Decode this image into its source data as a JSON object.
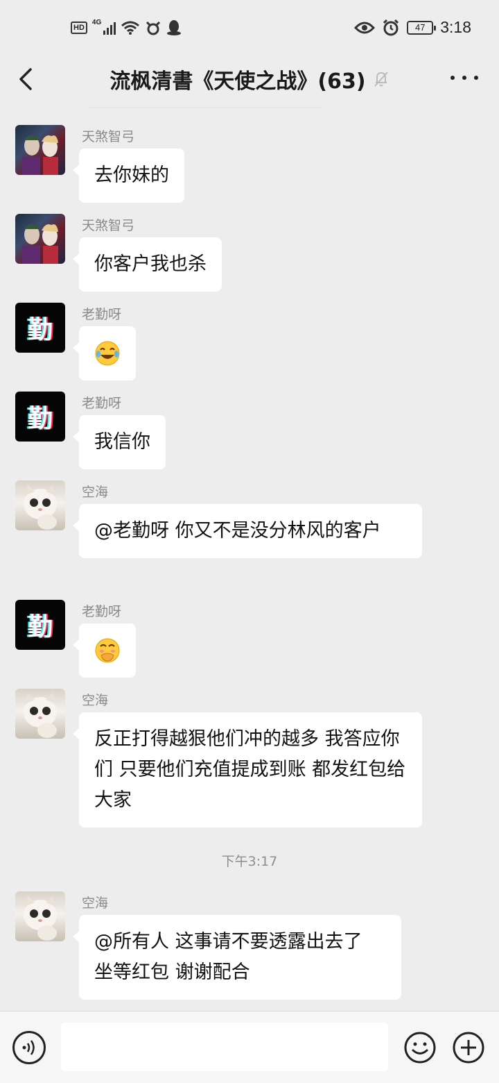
{
  "status_bar": {
    "hd": "HD",
    "network": "4G",
    "battery": "47",
    "time": "3:18"
  },
  "header": {
    "title": "流枫清書《天使之战》(63)",
    "back_icon": "back-chevron-icon",
    "mute_icon": "bell-muted-icon",
    "more_icon": "more-dots-icon"
  },
  "messages": [
    {
      "sender": "天煞智弓",
      "avatar": "joker-couple-avatar",
      "text": "去你妹的"
    },
    {
      "sender": "天煞智弓",
      "avatar": "joker-couple-avatar",
      "text": "你客户我也杀"
    },
    {
      "sender": "老勤呀",
      "avatar": "qin-char-avatar",
      "avatar_text": "勤",
      "emoji": "tears-of-joy-emoji"
    },
    {
      "sender": "老勤呀",
      "avatar": "qin-char-avatar",
      "avatar_text": "勤",
      "text": "我信你"
    },
    {
      "sender": "空海",
      "avatar": "cat-avatar",
      "text": "@老勤呀  你又不是没分林风的客户"
    },
    {
      "sender": "老勤呀",
      "avatar": "qin-char-avatar",
      "avatar_text": "勤",
      "emoji": "face-with-hand-over-mouth-emoji"
    },
    {
      "sender": "空海",
      "avatar": "cat-avatar",
      "text": "反正打得越狠他们冲的越多 我答应你们 只要他们充值提成到账 都发红包给大家"
    },
    {
      "sender": "空海",
      "avatar": "cat-avatar",
      "text": "@所有人  这事请不要透露出去了  坐等红包  谢谢配合"
    }
  ],
  "time_divider": "下午3:17",
  "input_bar": {
    "voice_icon": "voice-icon",
    "emoji_icon": "emoji-icon",
    "plus_icon": "plus-icon",
    "input_value": ""
  },
  "colors": {
    "background": "#ededed",
    "bubble": "#ffffff",
    "sender_name": "#8a8a8a"
  }
}
